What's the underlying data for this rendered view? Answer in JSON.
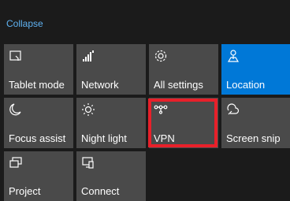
{
  "header": {
    "collapse_label": "Collapse"
  },
  "colors": {
    "tile": "#4a4a4a",
    "active_tile": "#0078d7",
    "highlight": "#e8202a",
    "link": "#5fb2f2"
  },
  "tiles": [
    {
      "label": "Tablet mode",
      "icon": "tablet-mode-icon",
      "active": false
    },
    {
      "label": "Network",
      "icon": "network-icon",
      "active": false
    },
    {
      "label": "All settings",
      "icon": "settings-gear-icon",
      "active": false
    },
    {
      "label": "Location",
      "icon": "location-icon",
      "active": true
    },
    {
      "label": "Focus assist",
      "icon": "moon-icon",
      "active": false
    },
    {
      "label": "Night light",
      "icon": "sun-icon",
      "active": false
    },
    {
      "label": "VPN",
      "icon": "vpn-icon",
      "active": false,
      "highlighted": true
    },
    {
      "label": "Screen snip",
      "icon": "screen-snip-icon",
      "active": false
    },
    {
      "label": "Project",
      "icon": "project-icon",
      "active": false
    },
    {
      "label": "Connect",
      "icon": "connect-icon",
      "active": false
    }
  ]
}
